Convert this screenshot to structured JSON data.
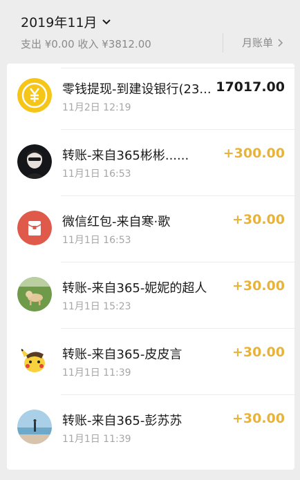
{
  "header": {
    "month": "2019年11月",
    "summary": "支出 ¥0.00 收入 ¥3812.00",
    "bill_label": "月账单"
  },
  "transactions": [
    {
      "title": "零钱提现-到建设银行(23...",
      "time": "11月2日 12:19",
      "amount": "17017.00",
      "icon": "yuan-coin-icon"
    },
    {
      "title": "转账-来自365彬彬......",
      "time": "11月1日 16:53",
      "amount": "+300.00",
      "icon": "avatar-man-dark"
    },
    {
      "title": "微信红包-来自寒·歌",
      "time": "11月1日 16:53",
      "amount": "+30.00",
      "icon": "red-packet-icon"
    },
    {
      "title": "转账-来自365-妮妮的超人",
      "time": "11月1日 15:23",
      "amount": "+30.00",
      "icon": "avatar-dog-grass"
    },
    {
      "title": "转账-来自365-皮皮言",
      "time": "11月1日 11:39",
      "amount": "+30.00",
      "icon": "avatar-pikachu"
    },
    {
      "title": "转账-来自365-彭苏苏",
      "time": "11月1日 11:39",
      "amount": "+30.00",
      "icon": "avatar-beach"
    }
  ],
  "colors": {
    "income": "#e8b33a",
    "expense": "#1a1a1a",
    "background": "#ededed"
  }
}
